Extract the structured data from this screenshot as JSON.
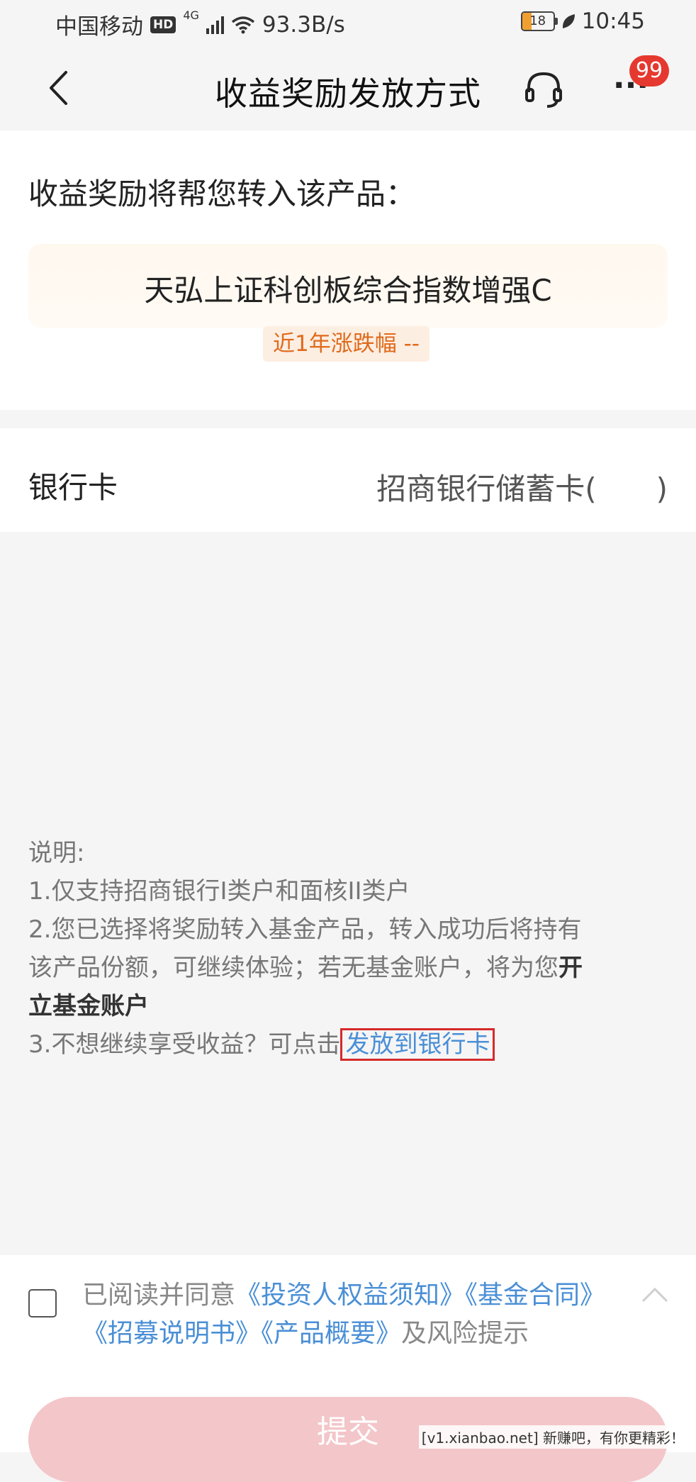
{
  "status_bar": {
    "carrier": "中国移动",
    "hd": "HD",
    "network": "4G",
    "speed": "93.3B/s",
    "battery": "18",
    "time": "10:45"
  },
  "nav": {
    "title": "收益奖励发放方式",
    "badge": "99",
    "more": "···"
  },
  "product": {
    "intro": "收益奖励将帮您转入该产品：",
    "name": "天弘上证科创板综合指数增强C",
    "performance": "近1年涨跌幅 --"
  },
  "bank": {
    "label": "银行卡",
    "value": "招商银行储蓄卡(　　)"
  },
  "explanation": {
    "heading": "说明:",
    "line1": "1.仅支持招商银行I类户和面核II类户",
    "line2": "2.您已选择将奖励转入基金产品，转入成功后将持有",
    "line3a": "该产品份额，可继续体验；若无基金账户，将为您",
    "line3b": "开",
    "line4": "立基金账户",
    "line5": "3.不想继续享受收益？可点击",
    "link": "发放到银行卡"
  },
  "agreement": {
    "prefix": "已阅读并同意",
    "doc1": "《投资人权益须知》",
    "doc2": "《基金合同》",
    "doc3": "《招募说明书》",
    "doc4": "《产品概要》",
    "suffix": "及风险提示"
  },
  "submit_label": "提交",
  "watermark": "[v1.xianbao.net] 新赚吧，有你更精彩！",
  "colors": {
    "accent_link": "#4a8fd6",
    "badge": "#e5392f",
    "perf_tag": "#e06a1b",
    "submit_disabled": "#f3c6c9"
  }
}
